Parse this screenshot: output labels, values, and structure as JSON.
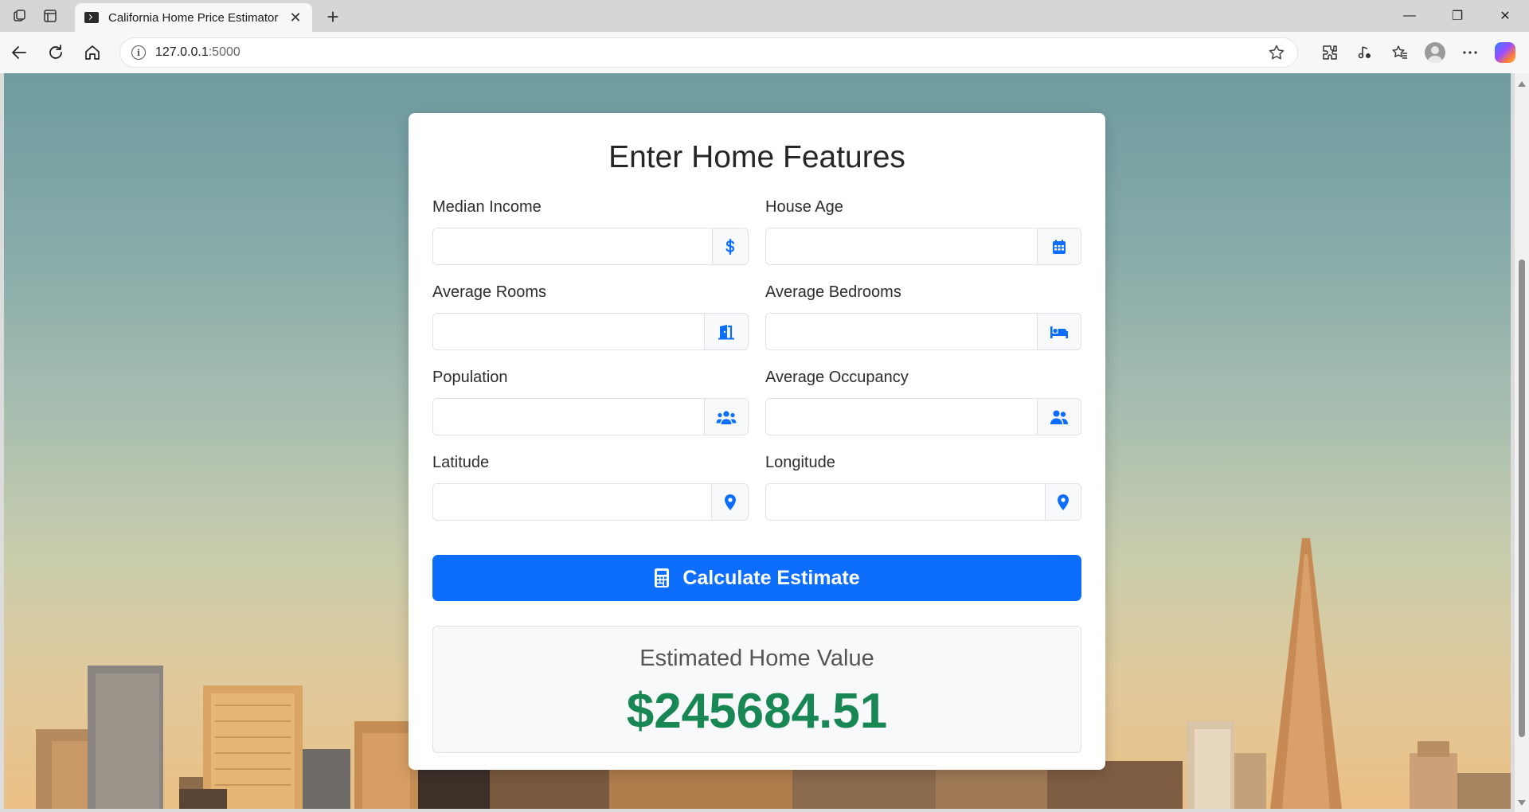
{
  "browser": {
    "tab": {
      "title": "California Home Price Estimator",
      "close_glyph": "✕"
    },
    "new_tab_glyph": "+",
    "address": {
      "host": "127.0.0.1",
      "port": ":5000"
    },
    "window_controls": {
      "minimize": "—",
      "maximize": "❐",
      "close": "✕"
    }
  },
  "form": {
    "title": "Enter Home Features",
    "fields": [
      {
        "label": "Median Income",
        "value": "",
        "icon": "dollar-icon"
      },
      {
        "label": "House Age",
        "value": "",
        "icon": "calendar-icon"
      },
      {
        "label": "Average Rooms",
        "value": "",
        "icon": "door-icon"
      },
      {
        "label": "Average Bedrooms",
        "value": "",
        "icon": "bed-icon"
      },
      {
        "label": "Population",
        "value": "",
        "icon": "users-icon"
      },
      {
        "label": "Average Occupancy",
        "value": "",
        "icon": "user-friends-icon"
      },
      {
        "label": "Latitude",
        "value": "",
        "icon": "map-pin-icon"
      },
      {
        "label": "Longitude",
        "value": "",
        "icon": "map-pin-icon"
      }
    ],
    "submit_label": "Calculate Estimate"
  },
  "result": {
    "title": "Estimated Home Value",
    "value": "$245684.51"
  },
  "colors": {
    "primary": "#0d6efd",
    "success": "#198754"
  }
}
